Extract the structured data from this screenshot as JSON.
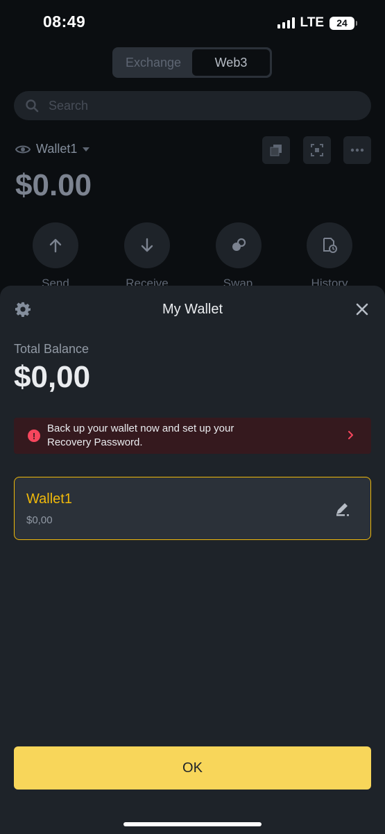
{
  "status_bar": {
    "time": "08:49",
    "network": "LTE",
    "battery": "24"
  },
  "tabs": [
    {
      "label": "Exchange",
      "active": false
    },
    {
      "label": "Web3",
      "active": true
    }
  ],
  "search": {
    "placeholder": "Search"
  },
  "wallet_header": {
    "name": "Wallet1",
    "balance": "$0.00"
  },
  "tools": [
    "copy-icon",
    "scan-icon",
    "more-icon"
  ],
  "actions": [
    {
      "label": "Send",
      "icon": "arrow-up-icon"
    },
    {
      "label": "Receive",
      "icon": "arrow-down-icon"
    },
    {
      "label": "Swap",
      "icon": "swap-icon"
    },
    {
      "label": "History",
      "icon": "history-icon"
    }
  ],
  "sheet": {
    "title": "My Wallet",
    "total_balance_label": "Total Balance",
    "total_balance_value": "$0,00",
    "alert_line1": "Back up your wallet now and set up your",
    "alert_line2": "Recovery Password.",
    "wallet_card": {
      "name": "Wallet1",
      "balance": "$0,00"
    },
    "ok_label": "OK"
  },
  "colors": {
    "accent": "#f0b90b",
    "button": "#f8d65a",
    "alert": "#f6465d",
    "sheet_bg": "#1e2329",
    "page_bg": "#0b0e11"
  }
}
